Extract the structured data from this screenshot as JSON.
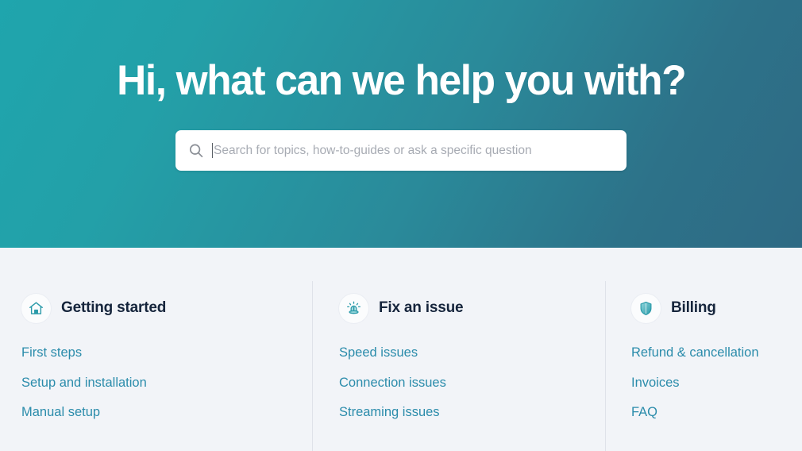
{
  "hero": {
    "title": "Hi, what can we help you with?",
    "gradient_from": "#22a3a8",
    "gradient_to": "#2e6a84",
    "title_color": "#ffffff"
  },
  "search": {
    "icon": "search-icon",
    "value": "",
    "placeholder": "Search for topics, how-to-guides or ask a specific question",
    "placeholder_color": "#a7abb3",
    "background": "#ffffff"
  },
  "categories": {
    "background": "#f2f4f8",
    "link_color": "#2b8cab",
    "heading_color": "#16253c",
    "columns": [
      {
        "icon": "home-icon",
        "title": "Getting started",
        "links": [
          "First steps",
          "Setup and installation",
          "Manual setup"
        ]
      },
      {
        "icon": "siren-icon",
        "title": "Fix an issue",
        "links": [
          "Speed issues",
          "Connection issues",
          "Streaming issues"
        ]
      },
      {
        "icon": "shield-icon",
        "title": "Billing",
        "links": [
          "Refund & cancellation",
          "Invoices",
          "FAQ"
        ]
      }
    ]
  }
}
